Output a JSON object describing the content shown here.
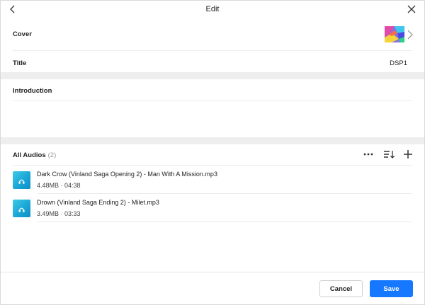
{
  "header": {
    "title": "Edit",
    "back_icon": "chevron-left-icon",
    "close_icon": "close-icon"
  },
  "cover": {
    "label": "Cover",
    "thumbnail": "album-art-thumbnail",
    "arrow_icon": "chevron-right-icon"
  },
  "title_row": {
    "label": "Title",
    "value": "DSP1"
  },
  "introduction": {
    "label": "Introduction",
    "value": ""
  },
  "audios": {
    "label": "All Audios",
    "count": "(2)",
    "tools": [
      "more-icon",
      "sort-icon",
      "add-icon"
    ],
    "items": [
      {
        "name": "Dark Crow (Vinland Saga Opening 2) - Man With A Mission.mp3",
        "meta": "4.48MB · 04:38"
      },
      {
        "name": "Drown (Vinland Saga Ending 2) - Milet.mp3",
        "meta": "3.49MB · 03:33"
      }
    ]
  },
  "footer": {
    "cancel_label": "Cancel",
    "save_label": "Save"
  },
  "colors": {
    "accent": "#1677ff",
    "band": "#eeeeee",
    "audio_icon": "#1aa7d6"
  }
}
